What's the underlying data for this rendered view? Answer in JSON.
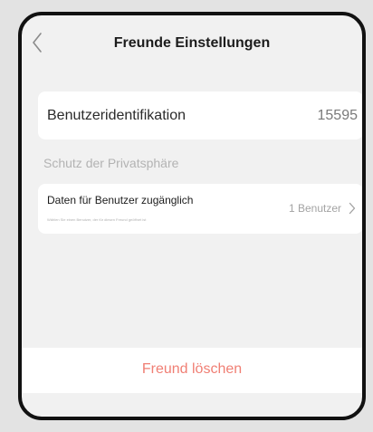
{
  "header": {
    "title": "Freunde Einstellungen",
    "back_icon": "chevron-left-icon"
  },
  "user_id": {
    "label": "Benutzeridentifikation",
    "value": "15595"
  },
  "privacy": {
    "section_title": "Schutz der Privatsphäre",
    "data_access_label": "Daten für Benutzer zugänglich",
    "data_access_hint": "Wählen Sie einen Benutzer, der für diesen Freund geöffnet ist",
    "data_access_value": "1 Benutzer",
    "chevron_icon": "chevron-right-icon"
  },
  "actions": {
    "delete_label": "Freund löschen",
    "delete_color": "#f07f74"
  },
  "colors": {
    "background": "#f1f1f1",
    "card": "#ffffff",
    "frame": "#111111"
  }
}
